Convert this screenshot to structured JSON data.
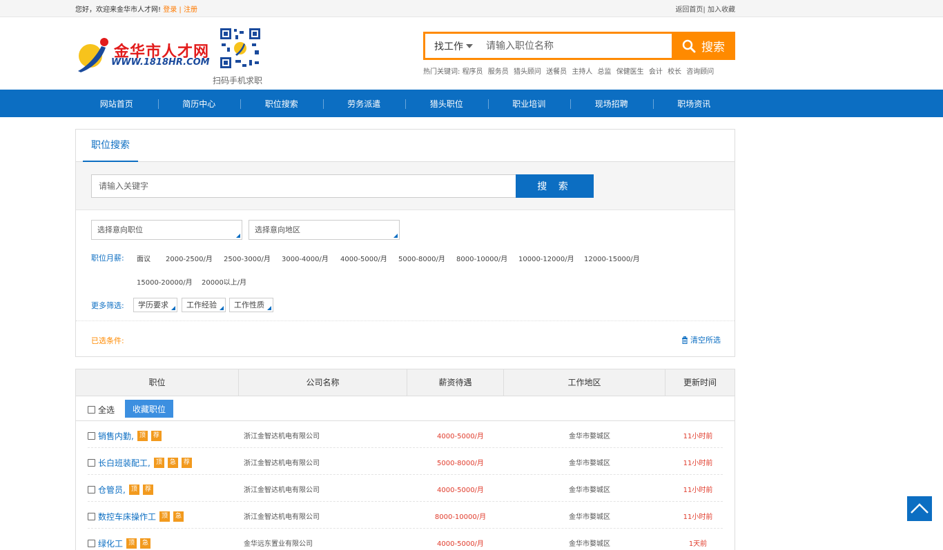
{
  "topbar": {
    "welcome": "您好，欢迎来金华市人才网!",
    "login": "登录",
    "sep": "|",
    "register": "注册",
    "home": "返回首页|",
    "favorite": "加入收藏"
  },
  "logo": {
    "title": "金华市人才网",
    "url": "WWW.1818HR.COM",
    "qr_caption": "扫码手机求职"
  },
  "search": {
    "type_label": "找工作",
    "placeholder": "请输入职位名称",
    "button": "搜索",
    "hot_label": "热门关键词:",
    "hot_words": [
      "程序员",
      "服务员",
      "猎头顾问",
      "送餐员",
      "主持人",
      "总监",
      "保健医生",
      "会计",
      "校长",
      "咨询顾问"
    ]
  },
  "nav": [
    "网站首页",
    "简历中心",
    "职位搜索",
    "劳务派遣",
    "猎头职位",
    "职业培训",
    "现场招聘",
    "职场资讯"
  ],
  "panel": {
    "tab": "职位搜索",
    "keyword_placeholder": "请输入关键字",
    "search_button": "搜 索",
    "select_position": "选择意向职位",
    "select_area": "选择意向地区",
    "salary_label": "职位月薪:",
    "salaries": [
      "面议",
      "2000-2500/月",
      "2500-3000/月",
      "3000-4000/月",
      "4000-5000/月",
      "5000-8000/月",
      "8000-10000/月",
      "10000-12000/月",
      "12000-15000/月",
      "15000-20000/月",
      "20000以上/月"
    ],
    "more_label": "更多筛选:",
    "more_filters": [
      "学历要求",
      "工作经验",
      "工作性质"
    ],
    "selected_label": "已选条件:",
    "clear_all": "清空所选"
  },
  "table": {
    "headers": [
      "职位",
      "公司名称",
      "薪资待遇",
      "工作地区",
      "更新时间"
    ],
    "select_all": "全选",
    "fav_button": "收藏职位",
    "rows": [
      {
        "title": "销售内勤,",
        "badges": [
          "顶",
          "荐"
        ],
        "company": "浙江金智达机电有限公司",
        "salary": "4000-5000/月",
        "area": "金华市婺城区",
        "time": "11小时前"
      },
      {
        "title": "长白班装配工,",
        "badges": [
          "顶",
          "急",
          "荐"
        ],
        "company": "浙江金智达机电有限公司",
        "salary": "5000-8000/月",
        "area": "金华市婺城区",
        "time": "11小时前"
      },
      {
        "title": "仓管员,",
        "badges": [
          "顶",
          "荐"
        ],
        "company": "浙江金智达机电有限公司",
        "salary": "4000-5000/月",
        "area": "金华市婺城区",
        "time": "11小时前"
      },
      {
        "title": "数控车床操作工",
        "badges": [
          "顶",
          "急"
        ],
        "company": "浙江金智达机电有限公司",
        "salary": "8000-10000/月",
        "area": "金华市婺城区",
        "time": "11小时前"
      },
      {
        "title": "绿化工",
        "badges": [
          "顶",
          "急"
        ],
        "company": "金华远东置业有限公司",
        "salary": "4000-5000/月",
        "area": "金华市婺城区",
        "time": "1天前"
      }
    ]
  },
  "colors": {
    "brand_blue": "#0c6ec2",
    "accent_orange": "#ff8a00",
    "salary_red": "#e03b2b",
    "badge": "#f29a1e"
  }
}
